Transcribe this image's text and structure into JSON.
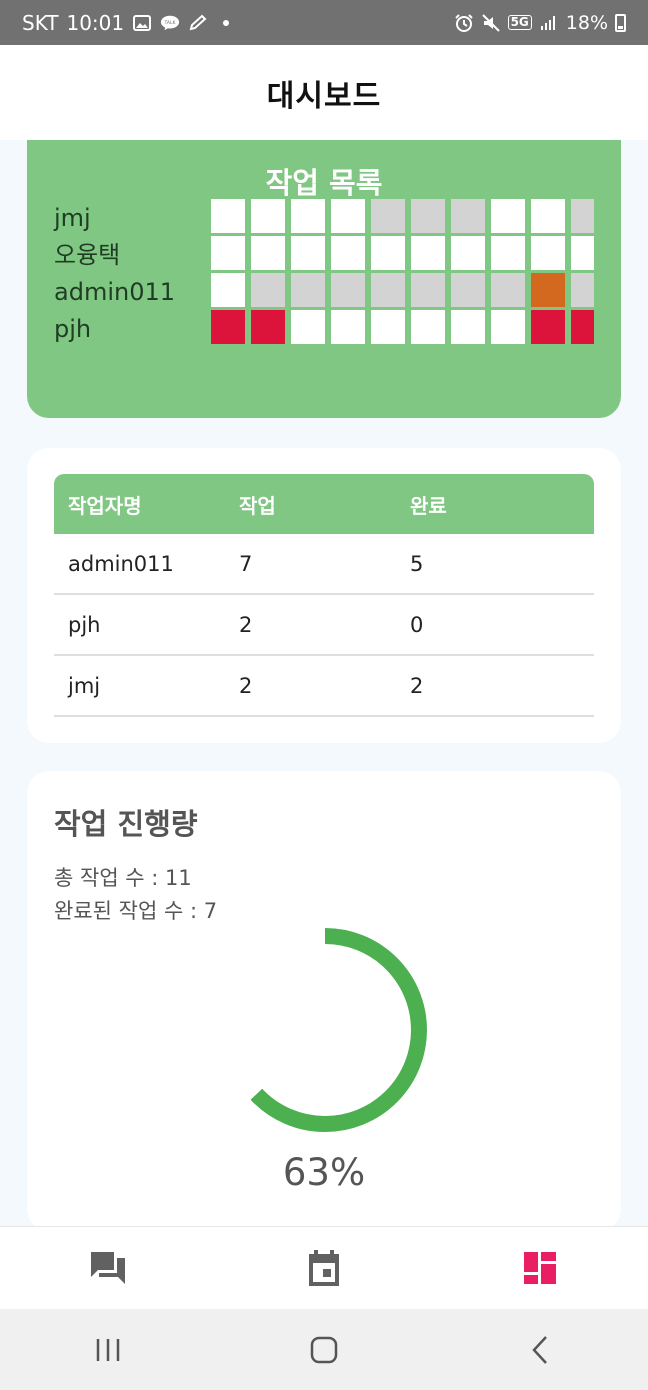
{
  "status_bar": {
    "carrier": "SKT",
    "time": "10:01",
    "network": "5G",
    "battery": "18%",
    "icons_left": [
      "gallery-icon",
      "kakaotalk-icon",
      "pen-icon",
      "dot-icon"
    ],
    "icons_right": [
      "alarm-icon",
      "mute-icon",
      "5g-icon",
      "signal-icon",
      "battery-icon"
    ]
  },
  "app_bar": {
    "title": "대시보드"
  },
  "task_list": {
    "title": "작업 목록",
    "users": [
      "jmj",
      "오융택",
      "admin011",
      "pjh"
    ],
    "grid_colors": {
      "w": "#ffffff",
      "g": "#d3d3d3",
      "r": "#dc143c",
      "o": "#d2691e"
    },
    "grid": [
      [
        "w",
        "w",
        "w",
        "w",
        "g",
        "g",
        "g",
        "w",
        "w",
        "g"
      ],
      [
        "w",
        "w",
        "w",
        "w",
        "w",
        "w",
        "w",
        "w",
        "w",
        "w"
      ],
      [
        "w",
        "g",
        "g",
        "g",
        "g",
        "g",
        "g",
        "g",
        "o",
        "g"
      ],
      [
        "r",
        "r",
        "w",
        "w",
        "w",
        "w",
        "w",
        "w",
        "r",
        "r"
      ]
    ]
  },
  "table": {
    "headers": [
      "작업자명",
      "작업",
      "완료"
    ],
    "rows": [
      [
        "admin011",
        "7",
        "5"
      ],
      [
        "pjh",
        "2",
        "0"
      ],
      [
        "jmj",
        "2",
        "2"
      ]
    ]
  },
  "progress": {
    "title": "작업 진행량",
    "total_label": "총 작업 수 : 11",
    "done_label": "완료된 작업 수 : 7",
    "percent_label": "63%",
    "fraction": 0.63,
    "color": "#4caf50"
  },
  "bottom_nav": [
    {
      "name": "chat-icon",
      "active": false
    },
    {
      "name": "calendar-icon",
      "active": false
    },
    {
      "name": "dashboard-icon",
      "active": true
    }
  ],
  "colors": {
    "accent": "#81c784",
    "active_tab": "#e91e63",
    "inactive_tab": "#616161"
  }
}
